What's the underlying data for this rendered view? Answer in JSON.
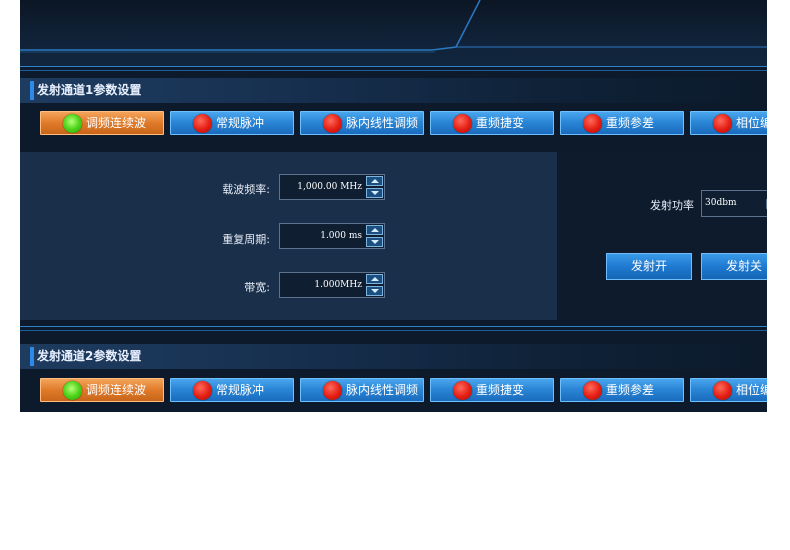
{
  "channel1": {
    "title": "发射通道1参数设置",
    "tabs": [
      {
        "label": "调频连续波",
        "active": true
      },
      {
        "label": "常规脉冲",
        "active": false
      },
      {
        "label": "脉内线性调频",
        "active": false
      },
      {
        "label": "重频捷变",
        "active": false
      },
      {
        "label": "重频参差",
        "active": false
      },
      {
        "label": "相位编码",
        "active": false
      }
    ],
    "fields": {
      "carrier_freq": {
        "label": "载波频率:",
        "value": "1,000.00 MHz"
      },
      "repeat_period": {
        "label": "重复周期:",
        "value": "1.000 ms"
      },
      "bandwidth": {
        "label": "带宽:",
        "value": "1.000MHz"
      }
    },
    "power": {
      "label": "发射功率",
      "value": "30dbm"
    },
    "buttons": {
      "tx_on": "发射开",
      "tx_off": "发射关"
    }
  },
  "channel2": {
    "title": "发射通道2参数设置",
    "tabs": [
      {
        "label": "调频连续波",
        "active": true
      },
      {
        "label": "常规脉冲",
        "active": false
      },
      {
        "label": "脉内线性调频",
        "active": false
      },
      {
        "label": "重频捷变",
        "active": false
      },
      {
        "label": "重频参差",
        "active": false
      },
      {
        "label": "相位编码",
        "active": false
      }
    ]
  },
  "colors": {
    "active_tab": "#e07a2a",
    "inactive_tab": "#2b86d6",
    "active_dot": "#4ed41b",
    "inactive_dot": "#e31d12",
    "background": "#0c1a2b"
  },
  "icons": {
    "active_indicator": "green-dot-icon",
    "inactive_indicator": "red-dot-icon",
    "spin_up": "triangle-up-icon",
    "spin_down": "triangle-down-icon"
  }
}
